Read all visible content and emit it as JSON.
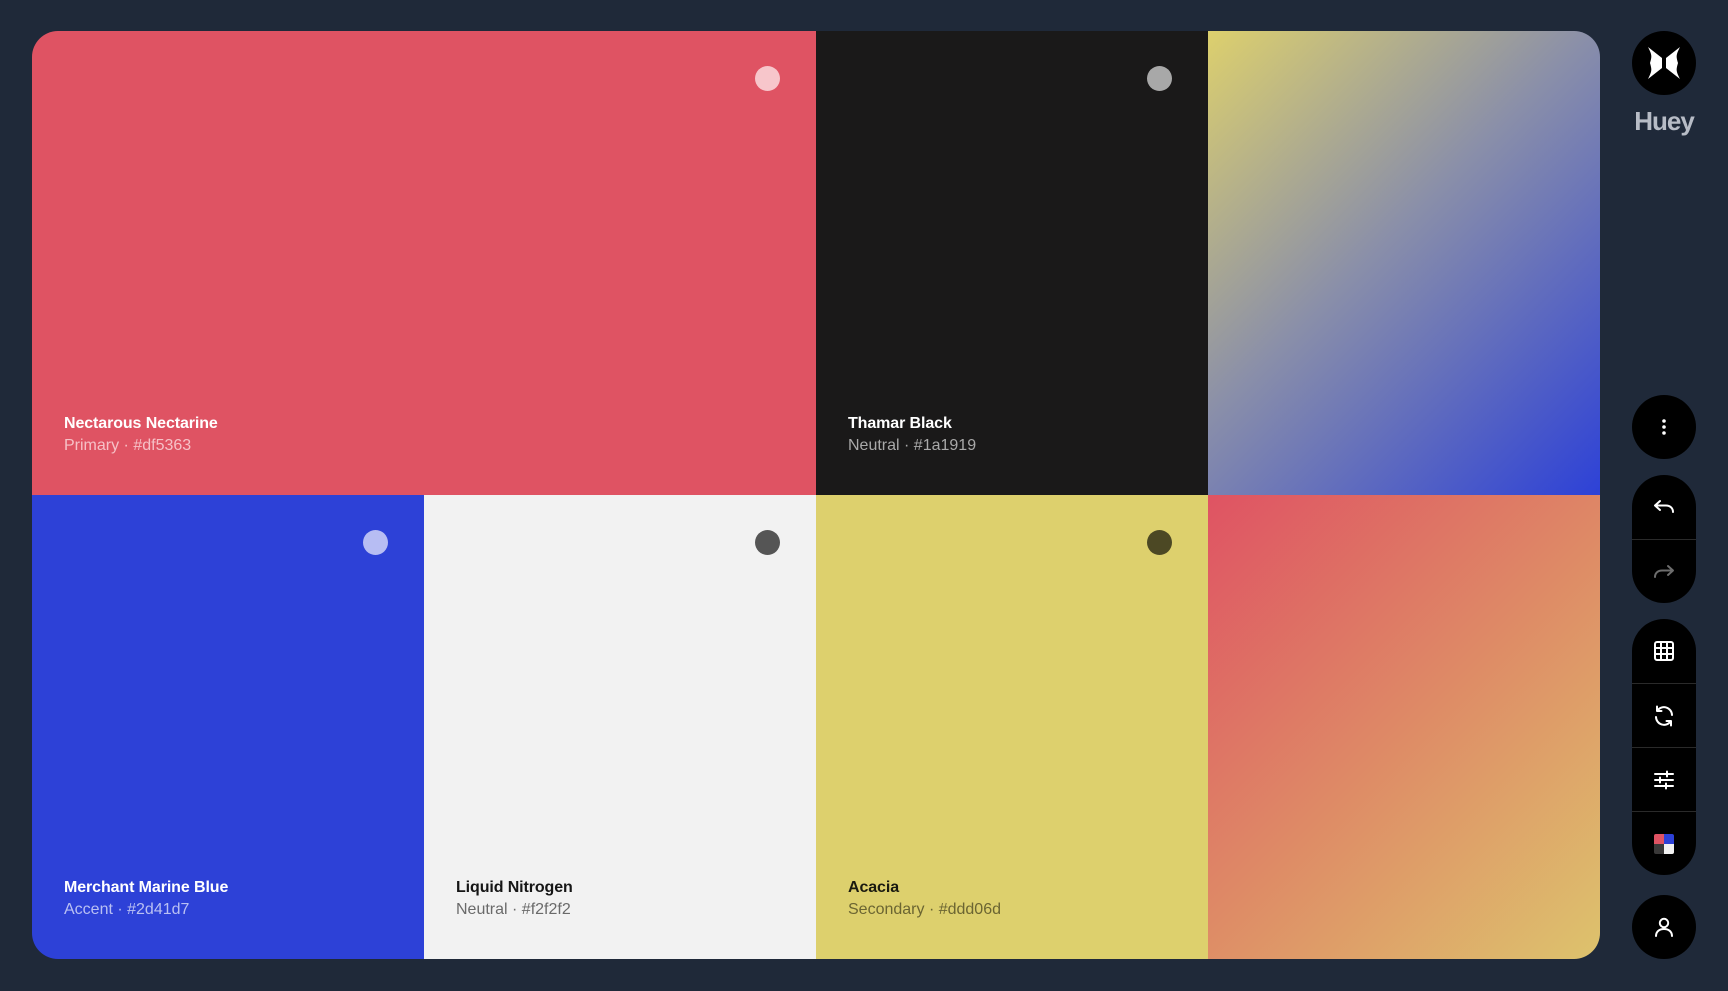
{
  "app": {
    "brand": "Huey"
  },
  "palette": [
    {
      "name": "Nectarous Nectarine",
      "sub": "Primary · #df5363",
      "hex": "#df5363"
    },
    {
      "name": "Thamar Black",
      "sub": "Neutral · #1a1919",
      "hex": "#1a1919"
    },
    {
      "name": "Merchant Marine Blue",
      "sub": "Accent · #2d41d7",
      "hex": "#2d41d7"
    },
    {
      "name": "Liquid Nitrogen",
      "sub": "Neutral · #f2f2f2",
      "hex": "#f2f2f2"
    },
    {
      "name": "Acacia",
      "sub": "Secondary · #ddd06d",
      "hex": "#ddd06d"
    }
  ],
  "gradients": [
    {
      "from": "#ddd06d",
      "to": "#2d41d7"
    },
    {
      "from": "#df5363",
      "to": "#ddc36d"
    }
  ],
  "toolbar": {
    "icons": [
      "butterfly-logo-icon",
      "more-vertical-icon",
      "undo-icon",
      "redo-icon",
      "grid-icon",
      "refresh-icon",
      "sliders-icon",
      "palette-swatch-icon",
      "user-icon"
    ]
  }
}
